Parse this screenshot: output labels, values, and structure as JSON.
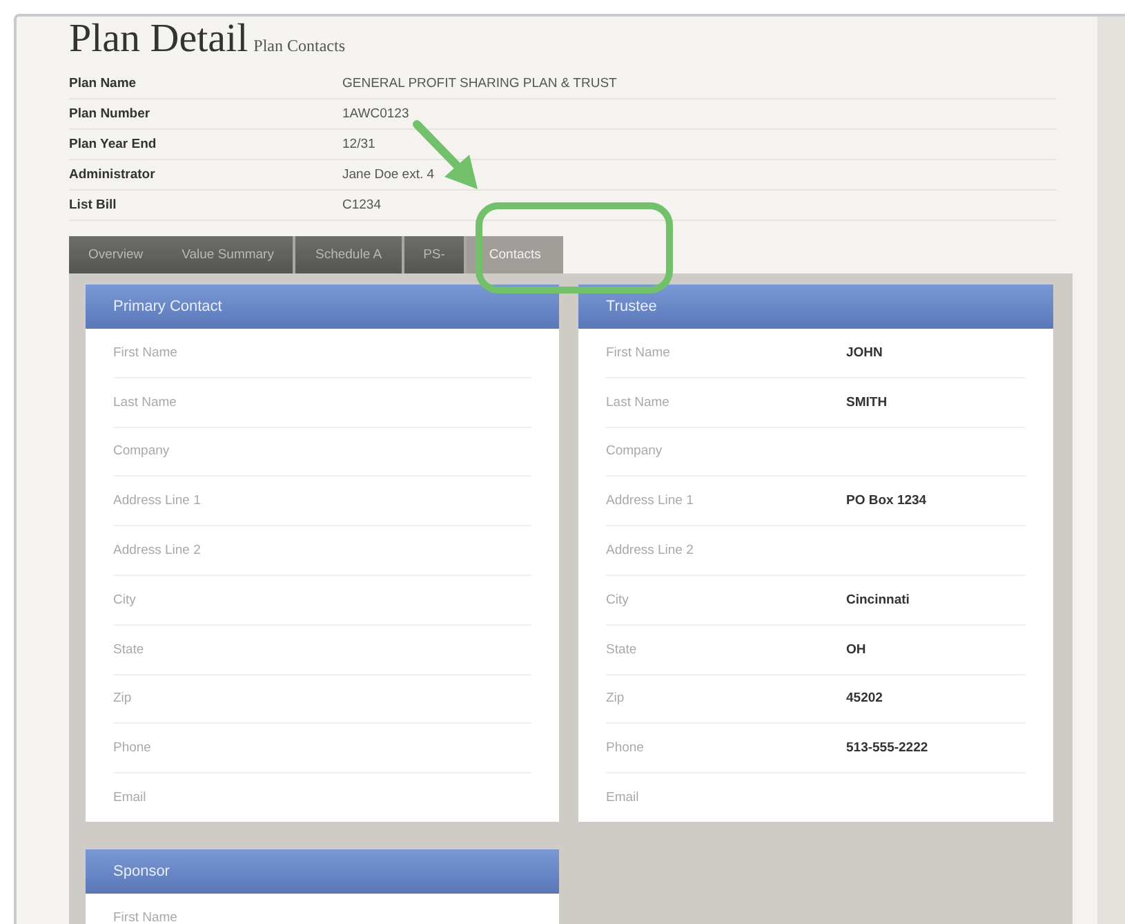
{
  "title": "Plan Detail",
  "subtitle": "Plan Contacts",
  "details": [
    {
      "label": "Plan Name",
      "value": "GENERAL PROFIT SHARING PLAN & TRUST"
    },
    {
      "label": "Plan Number",
      "value": "1AWC0123"
    },
    {
      "label": "Plan Year End",
      "value": "12/31"
    },
    {
      "label": "Administrator",
      "value": "Jane Doe ext. 4"
    },
    {
      "label": "List Bill",
      "value": "C1234"
    }
  ],
  "tabs": [
    {
      "label": "Overview",
      "selected": false
    },
    {
      "label": "Value Summary",
      "selected": false
    },
    {
      "label": "Schedule A",
      "selected": false
    },
    {
      "label": "PS-",
      "selected": false
    },
    {
      "label": "Contacts",
      "selected": true
    }
  ],
  "cards": [
    {
      "title": "Primary Contact",
      "fields": [
        {
          "label": "First Name"
        },
        {
          "label": "Last Name"
        },
        {
          "label": "Company"
        },
        {
          "label": "Address Line 1"
        },
        {
          "label": "Address Line 2"
        },
        {
          "label": "City"
        },
        {
          "label": "State"
        },
        {
          "label": "Zip"
        },
        {
          "label": "Phone"
        },
        {
          "label": "Email"
        }
      ]
    },
    {
      "title": "Trustee",
      "fields": [
        {
          "label": "First Name",
          "value": "JOHN"
        },
        {
          "label": "Last Name",
          "value": "SMITH"
        },
        {
          "label": "Company"
        },
        {
          "label": "Address Line 1",
          "value": "PO Box 1234"
        },
        {
          "label": "Address Line 2"
        },
        {
          "label": "City",
          "value": "Cincinnati"
        },
        {
          "label": "State",
          "value": "OH"
        },
        {
          "label": "Zip",
          "value": "45202"
        },
        {
          "label": "Phone",
          "value": "513-555-2222"
        },
        {
          "label": "Email"
        }
      ]
    },
    {
      "title": "Sponsor",
      "fields": [
        {
          "label": "First Name"
        }
      ]
    }
  ]
}
